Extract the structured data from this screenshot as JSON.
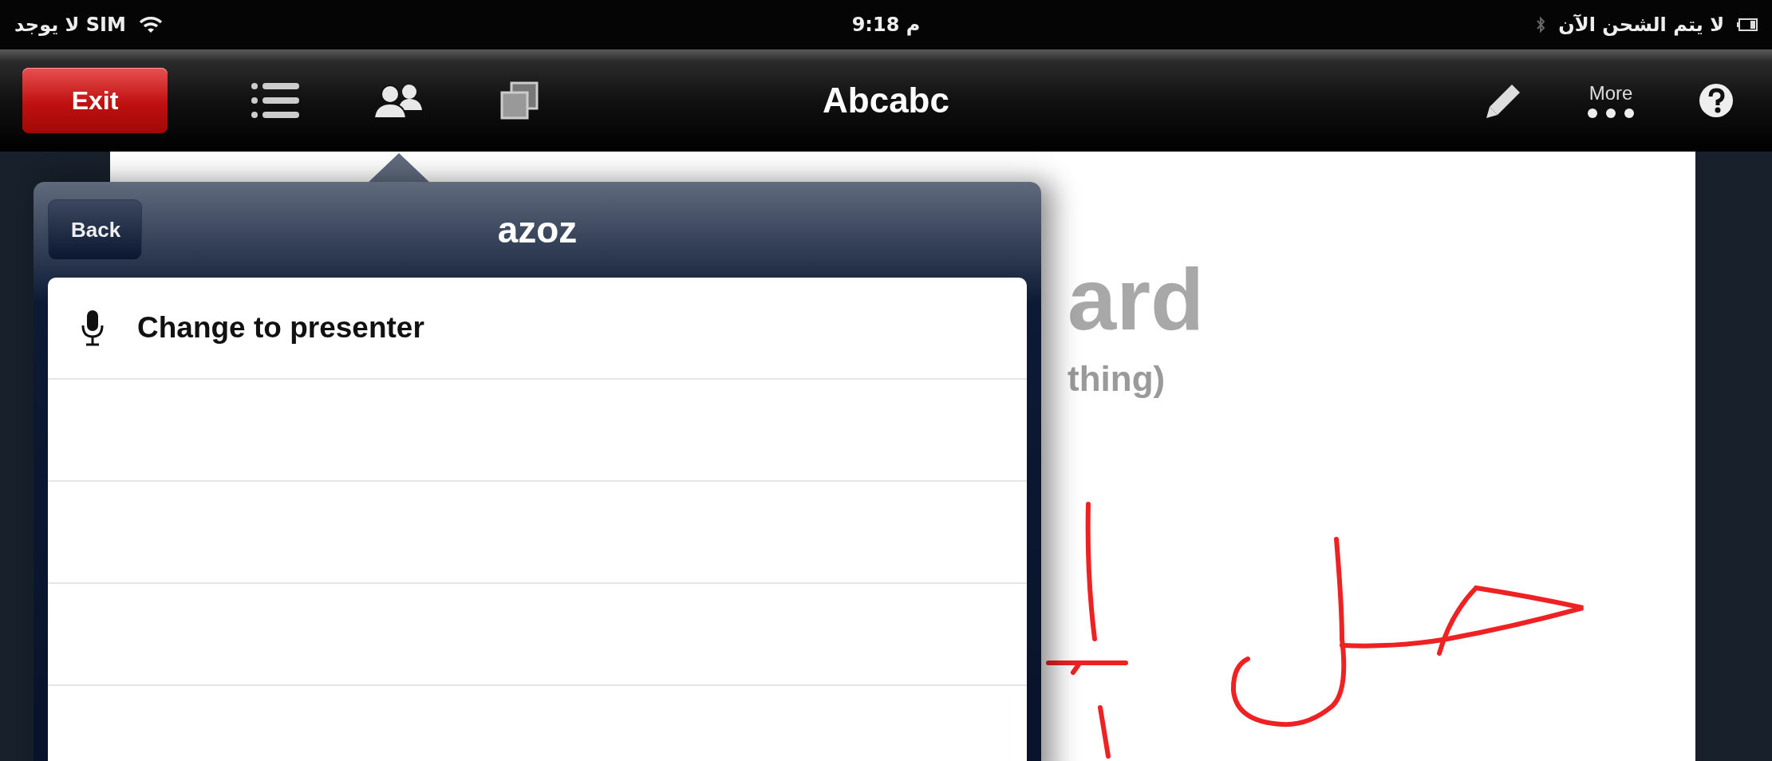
{
  "status_bar": {
    "carrier": "لا يوجد SIM",
    "time": "9:18 م",
    "charging": "لا يتم الشحن الآن"
  },
  "toolbar": {
    "exit": "Exit",
    "title": "Abcabc",
    "more": "More",
    "tools": [
      {
        "kind": "list",
        "selected": false
      },
      {
        "kind": "people",
        "selected": true
      },
      {
        "kind": "pages",
        "selected": false
      }
    ]
  },
  "popover": {
    "back": "Back",
    "title": "azoz",
    "rows": [
      {
        "kind": "mic",
        "label": "Change to presenter"
      }
    ]
  },
  "whiteboard": {
    "heading": "ard",
    "subheading": "thing)"
  }
}
